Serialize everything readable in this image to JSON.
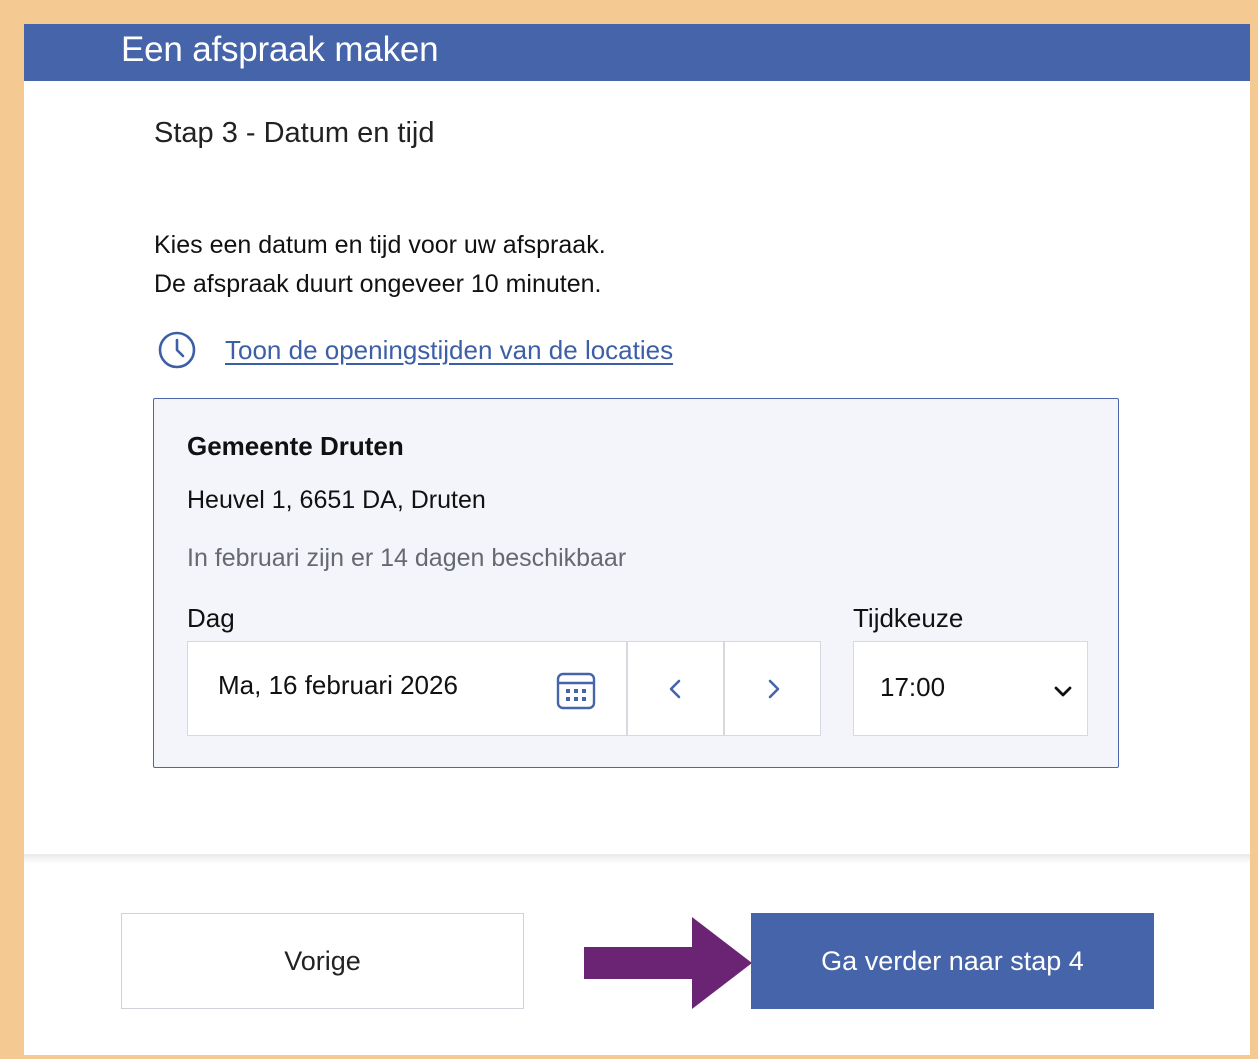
{
  "header": {
    "title": "Een afspraak maken"
  },
  "step": {
    "title": "Stap 3 - Datum en tijd"
  },
  "intro": {
    "line1": "Kies een datum en tijd voor uw afspraak.",
    "line2": "De afspraak duurt ongeveer 10 minuten."
  },
  "opening_hours_link": {
    "label": "Toon de openingstijden van de locaties",
    "icon": "clock-icon"
  },
  "location": {
    "name": "Gemeente Druten",
    "address": "Heuvel 1, 6651 DA, Druten",
    "availability": "In februari zijn er 14 dagen beschikbaar"
  },
  "date_picker": {
    "label": "Dag",
    "value": "Ma, 16 februari 2026",
    "icon": "calendar-icon",
    "prev_icon": "chevron-left-icon",
    "next_icon": "chevron-right-icon"
  },
  "time_select": {
    "label": "Tijdkeuze",
    "value": "17:00",
    "icon": "chevron-down-icon"
  },
  "footer": {
    "prev_label": "Vorige",
    "next_label": "Ga verder naar stap 4",
    "annotation_icon": "arrow-right-icon"
  },
  "colors": {
    "brand": "#4664a9",
    "link": "#3c5fa6",
    "border_frame": "#f5c992",
    "arrow": "#6b2473"
  }
}
